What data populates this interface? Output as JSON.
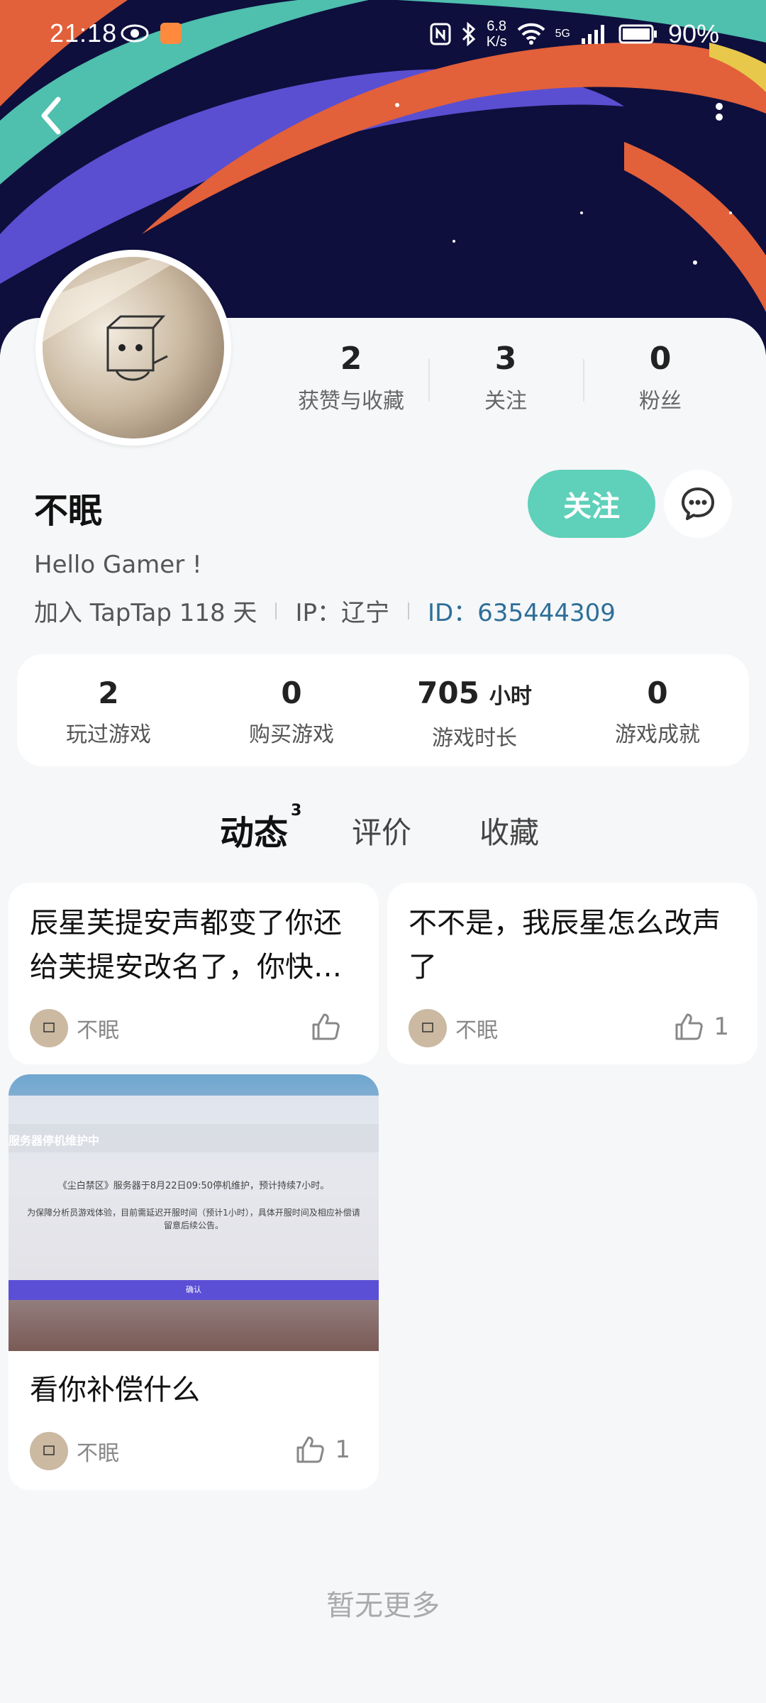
{
  "status_bar": {
    "time": "21:18",
    "net_speed_top": "6.8",
    "net_speed_bottom": "K/s",
    "signal_label": "5G",
    "battery": "90%"
  },
  "profile": {
    "name": "不眠",
    "bio": "Hello Gamer !",
    "joined": "加入 TapTap 118 天",
    "ip": "IP：辽宁",
    "id": "ID：635444309",
    "follow_label": "关注"
  },
  "social_stats": [
    {
      "num": "2",
      "label": "获赞与收藏"
    },
    {
      "num": "3",
      "label": "关注"
    },
    {
      "num": "0",
      "label": "粉丝"
    }
  ],
  "game_stats": [
    {
      "num": "2",
      "unit": "",
      "label": "玩过游戏"
    },
    {
      "num": "0",
      "unit": "",
      "label": "购买游戏"
    },
    {
      "num": "705",
      "unit": "小时",
      "label": "游戏时长"
    },
    {
      "num": "0",
      "unit": "",
      "label": "游戏成就"
    }
  ],
  "tabs": [
    {
      "label": "动态",
      "count": "3"
    },
    {
      "label": "评价"
    },
    {
      "label": "收藏"
    }
  ],
  "posts": [
    {
      "text": "辰星芙提安声都变了你还给芙提安改名了，你快…",
      "author": "不眠",
      "likes": ""
    },
    {
      "text": "不不是，我辰星怎么改声了",
      "author": "不眠",
      "likes": "1"
    },
    {
      "text": "看你补偿什么",
      "author": "不眠",
      "likes": "1",
      "image": {
        "title": "服务器停机维护中",
        "line1": "《尘白禁区》服务器于8月22日09:50停机维护，预计持续7小时。",
        "line2": "为保障分析员游戏体验，目前需延迟开服时间（预计1小时），具体开服时间及相应补偿请",
        "line3": "留意后续公告。",
        "confirm": "确认"
      }
    }
  ],
  "footer": "暂无更多",
  "colors": {
    "accent": "#5fd0b9",
    "id_link": "#2e6e98"
  }
}
